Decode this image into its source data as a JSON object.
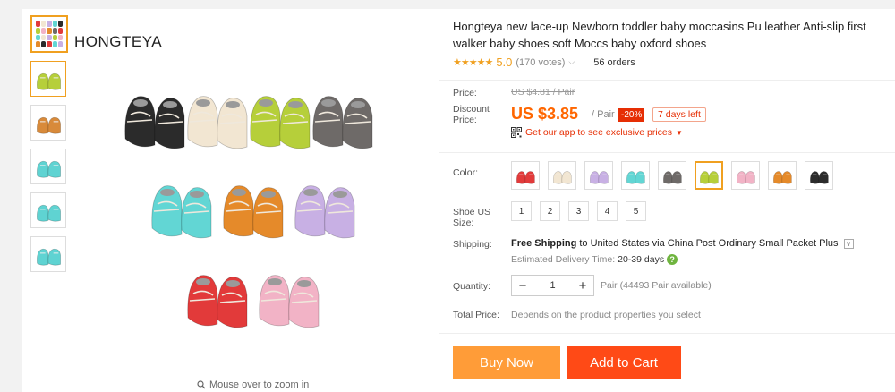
{
  "store": {
    "name": "HONGTEYA"
  },
  "gallery": {
    "zoom_hint": "Mouse over to zoom in",
    "thumbnails": [
      {
        "color": "#b6cf3a"
      },
      {
        "color": "#d88a3a"
      },
      {
        "color": "#5fd3d2"
      },
      {
        "color": "#5fd3d2"
      },
      {
        "color": "#5fd3d2"
      }
    ],
    "shoe_rows": [
      [
        "#2b2b2b",
        "#f2e6d2",
        "#b6cf3a",
        "#6e6a68"
      ],
      [
        "#62d6d4",
        "#e58a2a",
        "#c8b0e4"
      ],
      [
        "#e23a3a",
        "#f2b3c6"
      ]
    ]
  },
  "product": {
    "title": "Hongteya new lace-up Newborn toddler baby moccasins Pu leather Anti-slip first walker baby shoes soft Moccs baby oxford shoes",
    "stars": "★★★★★",
    "rating": "5.0",
    "votes": "(170 votes)",
    "orders": "56 orders"
  },
  "pricing": {
    "price_label": "Price:",
    "old_price": "US $4.81 / Pair",
    "discount_label_1": "Discount",
    "discount_label_2": "Price:",
    "price": "US $3.85",
    "unit": "/ Pair",
    "discount": "-20%",
    "days_left": "7 days left",
    "app_promo": "Get our app to see exclusive prices"
  },
  "options": {
    "color_label": "Color:",
    "colors": [
      "#e23a3a",
      "#f2e6d2",
      "#c8b0e4",
      "#62d6d4",
      "#6e6a68",
      "#b6cf3a",
      "#f2b3c6",
      "#e58a2a",
      "#2b2b2b"
    ],
    "selected_color_index": 5,
    "size_label_1": "Shoe US",
    "size_label_2": "Size:",
    "sizes": [
      "1",
      "2",
      "3",
      "4",
      "5"
    ]
  },
  "shipping": {
    "label": "Shipping:",
    "free": "Free Shipping",
    "rest": "to United States via China Post Ordinary Small Packet Plus",
    "eta_label": "Estimated Delivery Time:",
    "eta_days": "20-39 days"
  },
  "quantity": {
    "label": "Quantity:",
    "minus": "−",
    "value": "1",
    "plus": "+",
    "available": "Pair (44493 Pair available)"
  },
  "total": {
    "label": "Total Price:",
    "note": "Depends on the product properties you select"
  },
  "actions": {
    "buy_now": "Buy Now",
    "add_to_cart": "Add to Cart"
  }
}
